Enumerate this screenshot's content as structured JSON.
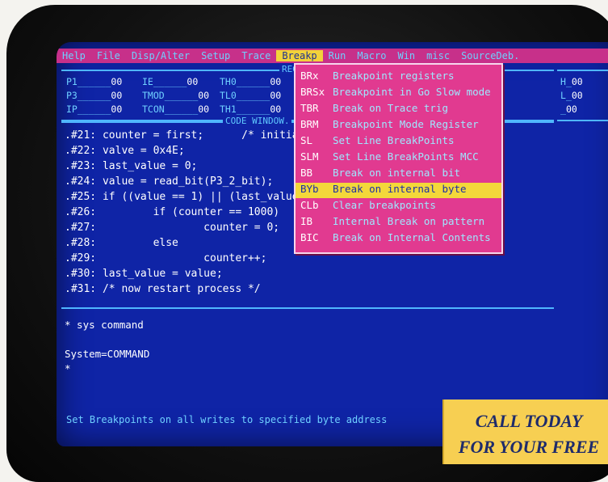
{
  "menu": {
    "items": [
      "Help",
      "File",
      "Disp/Alter",
      "Setup",
      "Trace",
      "Breakp",
      "Run",
      "Macro",
      "Win",
      "misc",
      "SourceDeb."
    ],
    "active_index": 5
  },
  "registers": {
    "title": "REG",
    "rows": [
      [
        {
          "name": "P1",
          "value": "00"
        },
        {
          "name": "IE",
          "value": "00"
        },
        {
          "name": "TH0",
          "value": "00"
        }
      ],
      [
        {
          "name": "P3",
          "value": "00"
        },
        {
          "name": "TMOD",
          "value": "00"
        },
        {
          "name": "TL0",
          "value": "00"
        }
      ],
      [
        {
          "name": "IP",
          "value": "00"
        },
        {
          "name": "TCON",
          "value": "00"
        },
        {
          "name": "TH1",
          "value": "00"
        }
      ]
    ],
    "right": [
      {
        "name": "H",
        "value": "00"
      },
      {
        "name": "L",
        "value": "00"
      },
      {
        "name": "",
        "value": "00"
      }
    ]
  },
  "code_window": {
    "title": "CODE WINDOW.",
    "lines": [
      ".#21: counter = first;      /* initia",
      ".#22: valve = 0x4E;",
      ".#23: last_value = 0;",
      ".#24: value = read_bit(P3_2_bit);",
      ".#25: if ((value == 1) || (last_value",
      ".#26:         if (counter == 1000)",
      ".#27:                 counter = 0;",
      ".#28:         else",
      ".#29:                 counter++;",
      ".#30: last_value = value;",
      ".#31: /* now restart process */"
    ]
  },
  "breakp_menu": {
    "items": [
      {
        "code": "BRx",
        "label": "Breakpoint registers"
      },
      {
        "code": "BRSx",
        "label": "Breakpoint in Go Slow mode"
      },
      {
        "code": "TBR",
        "label": "Break on Trace trig"
      },
      {
        "code": "BRM",
        "label": "Breakpoint Mode Register"
      },
      {
        "code": "SL",
        "label": "Set Line BreakPoints"
      },
      {
        "code": "SLM",
        "label": "Set Line BreakPoints MCC"
      },
      {
        "code": "BB",
        "label": "Break on internal bit"
      },
      {
        "code": "BYb",
        "label": "Break on internal byte"
      },
      {
        "code": "CLb",
        "label": "Clear breakpoints"
      },
      {
        "code": "IB",
        "label": "Internal Break on pattern"
      },
      {
        "code": "BIC",
        "label": "Break on Internal Contents"
      }
    ],
    "active_index": 7
  },
  "command": {
    "lines": [
      "* sys command",
      "",
      "System=COMMAND",
      "*"
    ]
  },
  "status_text": "Set Breakpoints on all writes to specified byte address",
  "banner": {
    "line1": "CALL TODAY",
    "line2": "FOR YOUR FREE"
  },
  "colors": {
    "screen_bg": "#0f24a6",
    "menu_bg": "#c7308a",
    "dropdown_bg": "#e13a90",
    "highlight": "#f3d83a",
    "banner_bg": "#f7cf52"
  }
}
